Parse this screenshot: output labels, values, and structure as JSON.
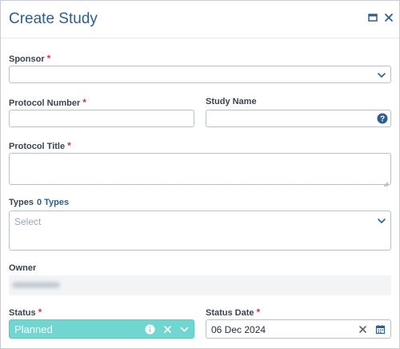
{
  "dialog": {
    "title": "Create Study"
  },
  "form": {
    "sponsor": {
      "label": "Sponsor",
      "required": "*"
    },
    "protocol_number": {
      "label": "Protocol Number",
      "required": "*"
    },
    "study_name": {
      "label": "Study Name"
    },
    "protocol_title": {
      "label": "Protocol Title",
      "required": "*"
    },
    "types": {
      "label": "Types",
      "count": "0 Types",
      "placeholder": "Select"
    },
    "owner": {
      "label": "Owner"
    },
    "status": {
      "label": "Status",
      "required": "*",
      "value": "Planned"
    },
    "status_date": {
      "label": "Status Date",
      "required": "*",
      "value": "06 Dec 2024"
    }
  },
  "colors": {
    "accent": "#2f5e8c",
    "required": "#e0304a",
    "status_planned": "#6fd6d0"
  }
}
